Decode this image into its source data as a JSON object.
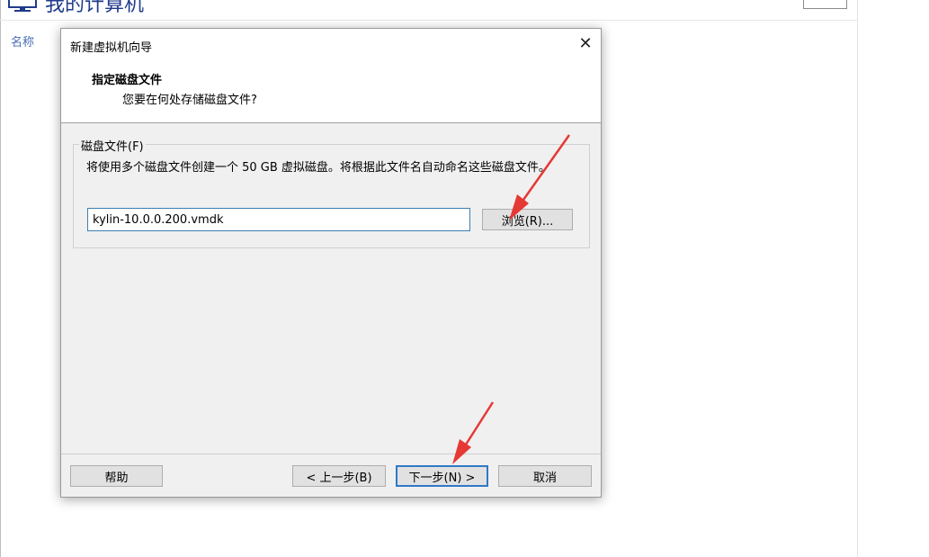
{
  "background": {
    "title": "我的计算机",
    "column_name": "名称"
  },
  "dialog": {
    "title": "新建虚拟机向导",
    "close_glyph": "✕",
    "header": {
      "heading": "指定磁盘文件",
      "subtitle": "您要在何处存储磁盘文件?"
    },
    "group_label": "磁盘文件(F)",
    "description": "将使用多个磁盘文件创建一个 50 GB 虚拟磁盘。将根据此文件名自动命名这些磁盘文件。",
    "file_value": "kylin-10.0.0.200.vmdk",
    "browse_label": "浏览(R)...",
    "buttons": {
      "help": "帮助",
      "back": "< 上一步(B)",
      "next": "下一步(N) >",
      "cancel": "取消"
    }
  },
  "colors": {
    "annotation_arrow": "#e53935",
    "focus_border": "#2f79c9",
    "dialog_bg": "#f0f0f0"
  }
}
